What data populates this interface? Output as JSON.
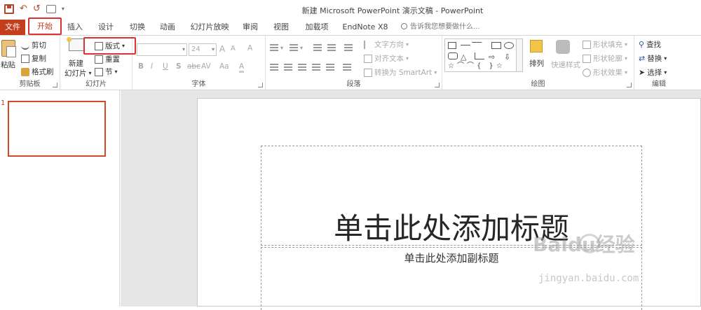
{
  "app": {
    "title": "新建 Microsoft PowerPoint 演示文稿 - PowerPoint"
  },
  "qat": {
    "save": "save",
    "undo": "↶",
    "redo": "↺",
    "touch": "touch-mode",
    "more": "▾"
  },
  "tabs": [
    {
      "label": "文件"
    },
    {
      "label": "开始"
    },
    {
      "label": "插入"
    },
    {
      "label": "设计"
    },
    {
      "label": "切换"
    },
    {
      "label": "动画"
    },
    {
      "label": "幻灯片放映"
    },
    {
      "label": "审阅"
    },
    {
      "label": "视图"
    },
    {
      "label": "加载项"
    },
    {
      "label": "EndNote X8"
    }
  ],
  "tell_me": "告诉我您想要做什么...",
  "clipboard": {
    "paste": "粘贴",
    "cut": "剪切",
    "copy": "复制",
    "format_painter": "格式刷",
    "label": "剪贴板"
  },
  "slides": {
    "new_slide_1": "新建",
    "new_slide_2": "幻灯片",
    "layout": "版式",
    "reset": "重置",
    "section": "节",
    "label": "幻灯片"
  },
  "font": {
    "size": "24",
    "bold": "B",
    "italic": "I",
    "underline": "U",
    "shadow": "S",
    "strike": "abc",
    "spacing": "AV",
    "case": "Aa",
    "grow": "A",
    "shrink": "A",
    "clear": "A",
    "label": "字体"
  },
  "paragraph": {
    "text_direction": "文字方向",
    "align_text": "对齐文本",
    "smartart": "转换为 SmartArt",
    "label": "段落"
  },
  "drawing": {
    "arrange": "排列",
    "quick_styles": "快速样式",
    "shape_fill": "形状填充",
    "shape_outline": "形状轮廓",
    "shape_effects": "形状效果",
    "label": "绘图"
  },
  "editing": {
    "find": "查找",
    "replace": "替换",
    "select": "选择",
    "label": "编辑"
  },
  "thumbs": [
    {
      "number": "1"
    }
  ],
  "slide": {
    "title_placeholder": "单击此处添加标题",
    "subtitle_placeholder": "单击此处添加副标题"
  },
  "watermark": {
    "logo": "Baidu经验",
    "url": "jingyan.baidu.com"
  }
}
